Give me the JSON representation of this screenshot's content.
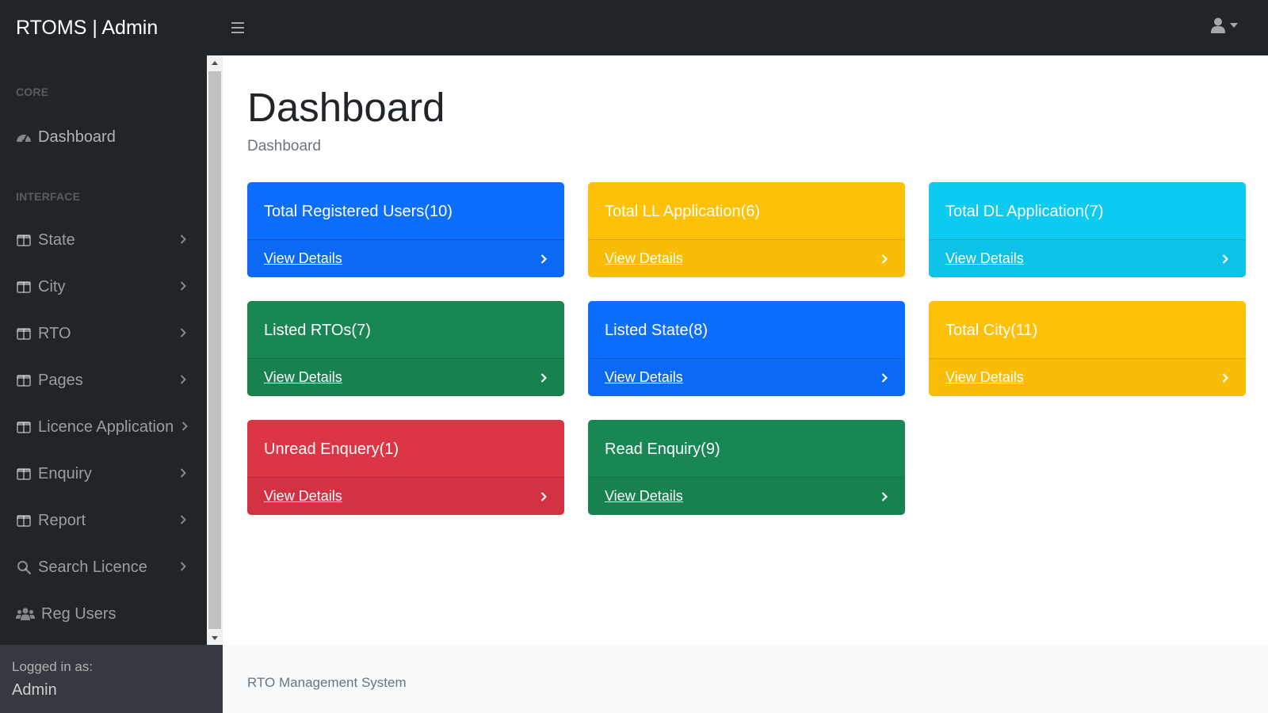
{
  "app": {
    "brand": "RTOMS | Admin"
  },
  "topnav": {
    "toggle_icon": "hamburger-icon",
    "user_icon": "user-icon"
  },
  "sidebar": {
    "headings": {
      "core": "CORE",
      "interface": "INTERFACE"
    },
    "items": [
      {
        "label": "Dashboard",
        "icon": "tachometer-icon",
        "has_chevron": false
      },
      {
        "label": "State",
        "icon": "columns-icon",
        "has_chevron": true
      },
      {
        "label": "City",
        "icon": "columns-icon",
        "has_chevron": true
      },
      {
        "label": "RTO",
        "icon": "columns-icon",
        "has_chevron": true
      },
      {
        "label": "Pages",
        "icon": "columns-icon",
        "has_chevron": true
      },
      {
        "label": "Licence Application",
        "icon": "columns-icon",
        "has_chevron": true
      },
      {
        "label": "Enquiry",
        "icon": "columns-icon",
        "has_chevron": true
      },
      {
        "label": "Report",
        "icon": "columns-icon",
        "has_chevron": true
      },
      {
        "label": "Search Licence",
        "icon": "search-icon",
        "has_chevron": true
      },
      {
        "label": "Reg Users",
        "icon": "users-icon",
        "has_chevron": false
      }
    ],
    "footer": {
      "logged_in_label": "Logged in as:",
      "user": "Admin"
    }
  },
  "main": {
    "title": "Dashboard",
    "breadcrumb": "Dashboard",
    "cards": [
      {
        "title": "Total Registered Users(10)",
        "link": "View Details",
        "color": "#0d6efd"
      },
      {
        "title": "Total LL Application(6)",
        "link": "View Details",
        "color": "#ffc107"
      },
      {
        "title": "Total DL Application(7)",
        "link": "View Details",
        "color": "#0dcaf0"
      },
      {
        "title": "Listed RTOs(7)",
        "link": "View Details",
        "color": "#198754"
      },
      {
        "title": "Listed State(8)",
        "link": "View Details",
        "color": "#0d6efd"
      },
      {
        "title": "Total City(11)",
        "link": "View Details",
        "color": "#ffc107"
      },
      {
        "title": "Unread Enquery(1)",
        "link": "View Details",
        "color": "#dc3545"
      },
      {
        "title": "Read Enquiry(9)",
        "link": "View Details",
        "color": "#198754"
      }
    ]
  },
  "footer": {
    "text": "RTO Management System"
  }
}
